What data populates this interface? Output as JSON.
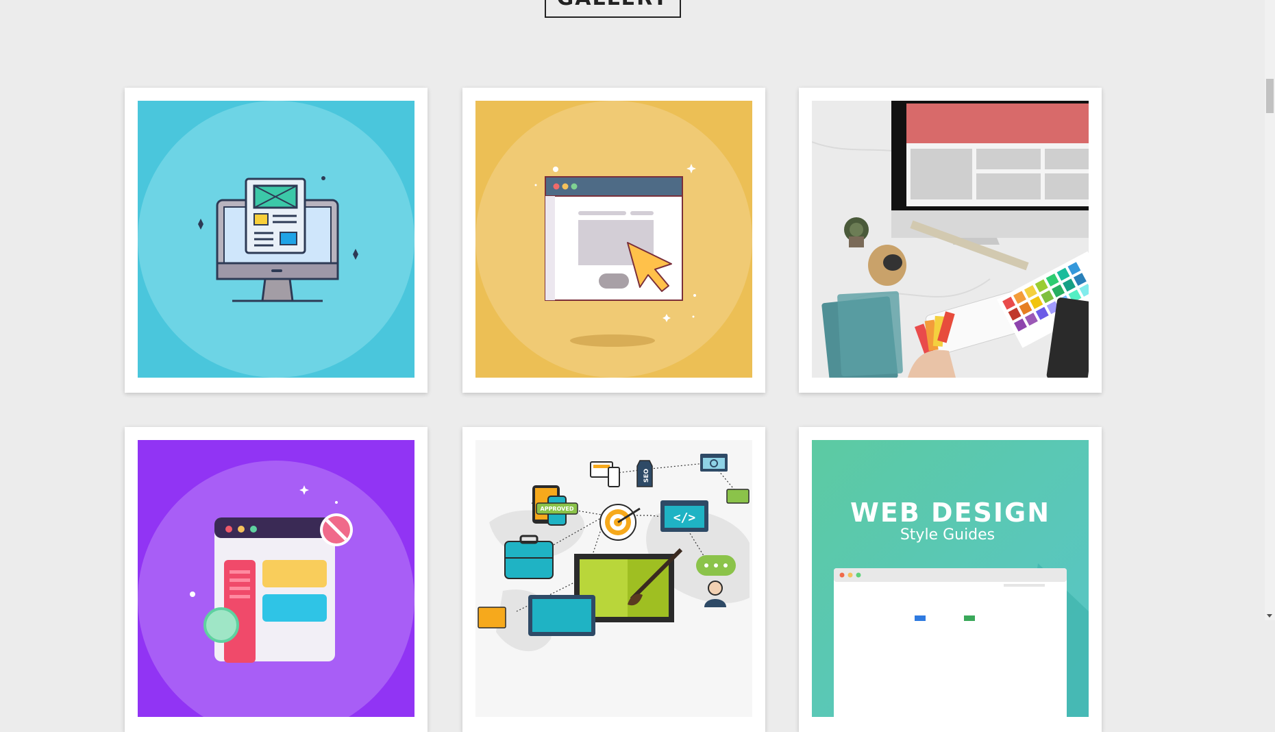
{
  "gallery": {
    "heading": "GALLERY",
    "items": [
      {
        "icon": "monitor-wireframe-illustration",
        "bg": "#4ac6dc"
      },
      {
        "icon": "browser-cursor-illustration",
        "bg": "#ecbf55"
      },
      {
        "icon": "designer-desk-photo",
        "bg": "#e8e8e8"
      },
      {
        "icon": "blocked-webpage-illustration",
        "bg": "#9134f4"
      },
      {
        "icon": "seo-network-illustration",
        "bg": "#f4f4f4"
      },
      {
        "icon": "style-guide-cover",
        "bg": "#5fcaa8"
      }
    ],
    "seo_badge": "SEO",
    "approved_badge": "APPROVED",
    "code_tag": "</>",
    "cover_title": "WEB DESIGN",
    "cover_subtitle": "Style Guides"
  },
  "colors": {
    "page_bg": "#ececec",
    "card_bg": "#ffffff",
    "heading_border": "#222222"
  }
}
